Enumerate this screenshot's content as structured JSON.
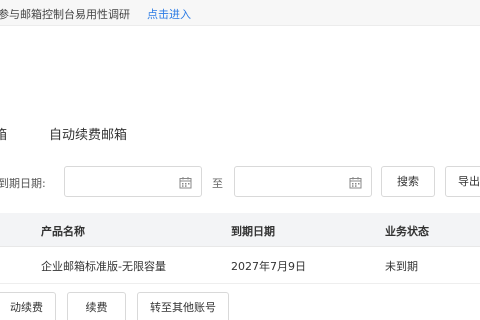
{
  "banner": {
    "text": "参与邮箱控制台易用性调研",
    "link": "点击进入"
  },
  "tabs": [
    {
      "label": "箱"
    },
    {
      "label": "自动续费邮箱"
    }
  ],
  "filter": {
    "label": "到期日期:",
    "start_value": "",
    "end_value": "",
    "separator": "至",
    "search_label": "搜索",
    "export_label": "导出"
  },
  "table": {
    "headers": [
      "产品名称",
      "到期日期",
      "业务状态"
    ],
    "rows": [
      {
        "product": "企业邮箱标准版-无限容量",
        "expiry": "2027年7月9日",
        "status": "未到期"
      }
    ]
  },
  "actions": {
    "auto_renew_label": "动续费",
    "renew_label": "续费",
    "transfer_label": "转至其他账号"
  }
}
